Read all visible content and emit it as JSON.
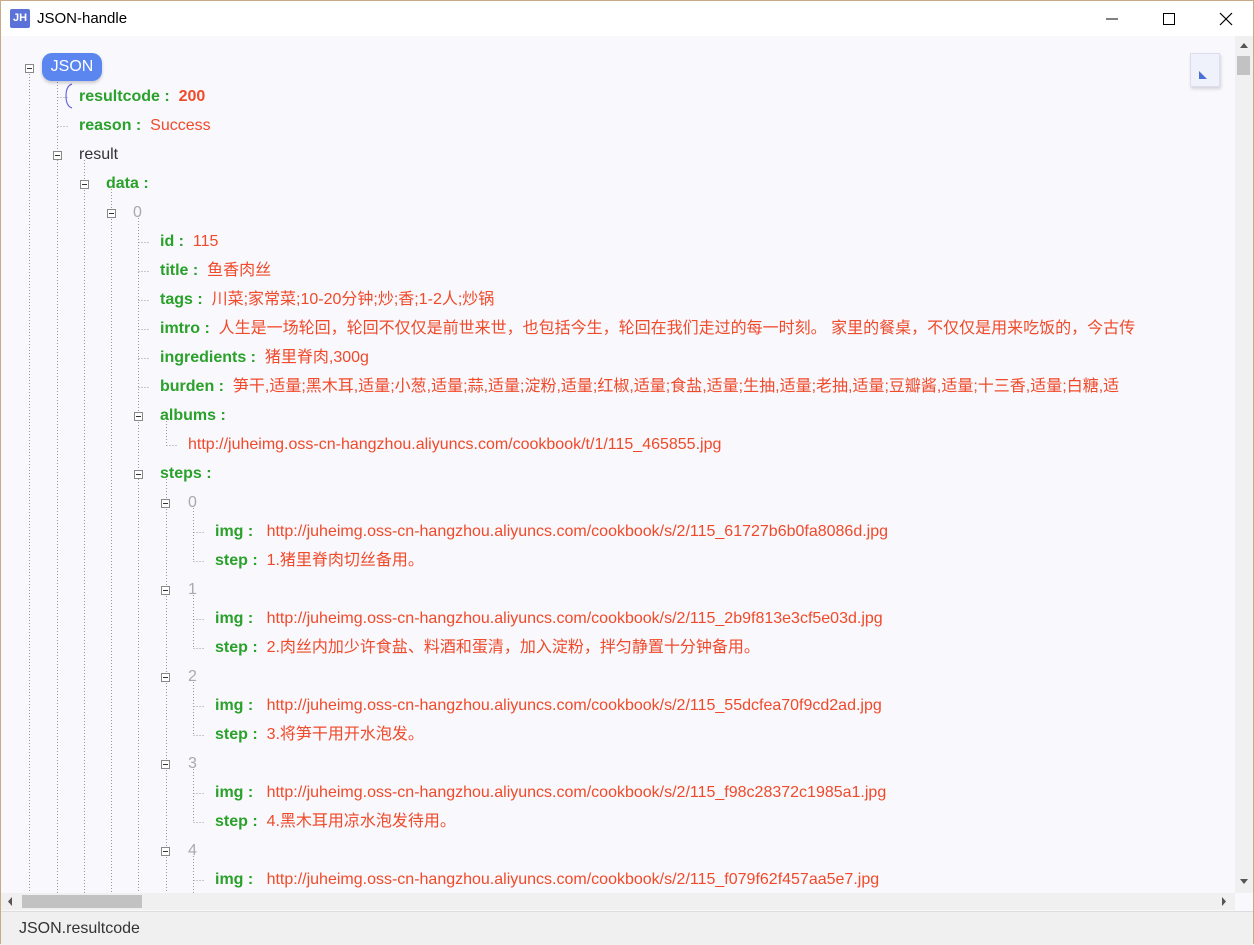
{
  "window": {
    "title": "JSON-handle",
    "icon_text": "JH",
    "controls": [
      "minimize",
      "maximize",
      "close"
    ]
  },
  "tree": {
    "root_label": "JSON",
    "rows": [
      {
        "key": "resultcode :",
        "value": "200"
      },
      {
        "key": "reason :",
        "value": "Success"
      },
      {
        "key": "result"
      },
      {
        "key": "data :"
      },
      {
        "index": "0"
      },
      {
        "key": "id :",
        "value": "115"
      },
      {
        "key": "title :",
        "value": "鱼香肉丝"
      },
      {
        "key": "tags :",
        "value": "川菜;家常菜;10-20分钟;炒;香;1-2人;炒锅"
      },
      {
        "key": "imtro :",
        "value": "人生是一场轮回，轮回不仅仅是前世来世，也包括今生，轮回在我们走过的每一时刻。 家里的餐桌，不仅仅是用来吃饭的，今古传"
      },
      {
        "key": "ingredients :",
        "value": "猪里脊肉,300g"
      },
      {
        "key": "burden :",
        "value": "笋干,适量;黑木耳,适量;小葱,适量;蒜,适量;淀粉,适量;红椒,适量;食盐,适量;生抽,适量;老抽,适量;豆瓣酱,适量;十三香,适量;白糖,适"
      },
      {
        "key": "albums :"
      },
      {
        "value": "http://juheimg.oss-cn-hangzhou.aliyuncs.com/cookbook/t/1/115_465855.jpg"
      },
      {
        "key": "steps :"
      },
      {
        "index": "0"
      },
      {
        "key": "img :",
        "value": "http://juheimg.oss-cn-hangzhou.aliyuncs.com/cookbook/s/2/115_61727b6b0fa8086d.jpg"
      },
      {
        "key": "step :",
        "value": "1.猪里脊肉切丝备用。"
      },
      {
        "index": "1"
      },
      {
        "key": "img :",
        "value": "http://juheimg.oss-cn-hangzhou.aliyuncs.com/cookbook/s/2/115_2b9f813e3cf5e03d.jpg"
      },
      {
        "key": "step :",
        "value": "2.肉丝内加少许食盐、料酒和蛋清，加入淀粉，拌匀静置十分钟备用。"
      },
      {
        "index": "2"
      },
      {
        "key": "img :",
        "value": "http://juheimg.oss-cn-hangzhou.aliyuncs.com/cookbook/s/2/115_55dcfea70f9cd2ad.jpg"
      },
      {
        "key": "step :",
        "value": "3.将笋干用开水泡发。"
      },
      {
        "index": "3"
      },
      {
        "key": "img :",
        "value": "http://juheimg.oss-cn-hangzhou.aliyuncs.com/cookbook/s/2/115_f98c28372c1985a1.jpg"
      },
      {
        "key": "step :",
        "value": "4.黑木耳用凉水泡发待用。"
      },
      {
        "index": "4"
      },
      {
        "key": "img :",
        "value": "http://juheimg.oss-cn-hangzhou.aliyuncs.com/cookbook/s/2/115_f079f62f457aa5e7.jpg"
      }
    ]
  },
  "status": {
    "path": "JSON.resultcode"
  }
}
